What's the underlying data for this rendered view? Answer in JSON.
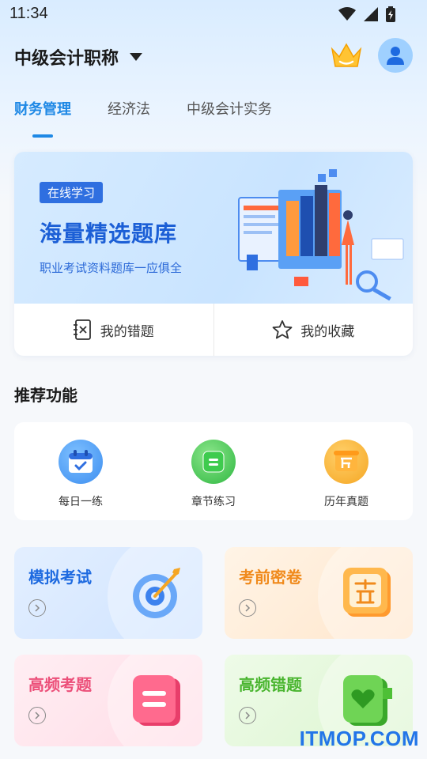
{
  "status_bar": {
    "time": "11:34"
  },
  "header": {
    "exam_title": "中级会计职称"
  },
  "tabs": [
    {
      "label": "财务管理",
      "active": true
    },
    {
      "label": "经济法",
      "active": false
    },
    {
      "label": "中级会计实务",
      "active": false
    }
  ],
  "banner": {
    "tag": "在线学习",
    "title": "海量精选题库",
    "subtitle": "职业考试资料题库一应俱全"
  },
  "quick_actions": [
    {
      "label": "我的错题",
      "icon": "wrong-questions-icon"
    },
    {
      "label": "我的收藏",
      "icon": "star-icon"
    }
  ],
  "recommended": {
    "title": "推荐功能",
    "items": [
      {
        "label": "每日一练",
        "icon": "calendar-icon",
        "color": "#3d8ef0"
      },
      {
        "label": "章节练习",
        "icon": "chapter-icon",
        "color": "#38c24a"
      },
      {
        "label": "历年真题",
        "icon": "history-icon",
        "color": "#f5a623"
      }
    ]
  },
  "cards": [
    {
      "title": "模拟考试",
      "icon": "target-icon",
      "color": "#1e6ae0"
    },
    {
      "title": "考前密卷",
      "icon": "secret-paper-icon",
      "color": "#f08a1c"
    },
    {
      "title": "高频考题",
      "icon": "frequent-questions-icon",
      "color": "#ec4f79"
    },
    {
      "title": "高频错题",
      "icon": "frequent-errors-icon",
      "color": "#49b52f"
    }
  ],
  "watermark": "ITMOP.COM"
}
